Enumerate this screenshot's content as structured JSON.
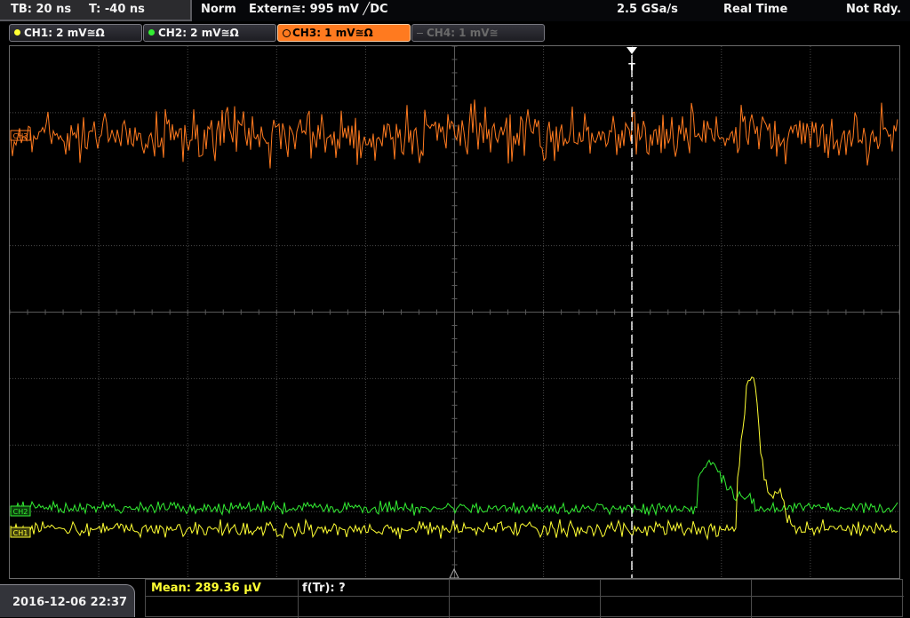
{
  "topbar": {
    "timebase": "TB: 20 ns",
    "trigger_time": "T: -40 ns",
    "trigger_mode": "Norm",
    "trigger_source": "Extern≅: 995 mV ╱DC",
    "sample_rate": "2.5 GSa/s",
    "acq_mode": "Real Time",
    "status": "Not Rdy."
  },
  "channels": [
    {
      "label": "CH1: 2 mV≅Ω",
      "color": "#ffff33",
      "active": false,
      "enabled": true
    },
    {
      "label": "CH2: 2 mV≅Ω",
      "color": "#33ee33",
      "active": false,
      "enabled": true
    },
    {
      "label": "CH3: 1 mV≅Ω",
      "color": "#ff7a1f",
      "active": true,
      "enabled": true
    },
    {
      "label": "CH4: 1 mV≅",
      "color": "#6a6a6a",
      "active": false,
      "enabled": false
    }
  ],
  "colors": {
    "ch1": "#ffff33",
    "ch2": "#33ee33",
    "ch3": "#ff7a1f",
    "grid": "#4a4a4a",
    "trigger": "#ffffff"
  },
  "trigger_marker": "T",
  "ch_markers": {
    "ch1": "CH1",
    "ch2": "CH2",
    "ch3": "CH3"
  },
  "bottom": {
    "datetime": "2016-12-06 22:37",
    "mean_label": "Mean: 289.36 µV",
    "freq_label": "f(Tr): ?"
  }
}
